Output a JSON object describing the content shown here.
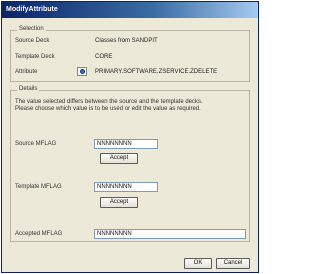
{
  "window": {
    "title": "ModifyAttribute"
  },
  "selection": {
    "group_title": "Selection",
    "source_deck_label": "Source Deck",
    "source_deck_value": "Classes from SANDPIT",
    "template_deck_label": "Template Deck",
    "template_deck_value": "CORE",
    "attribute_label": "Attribute",
    "attribute_value": "PRIMARY.SOFTWARE.ZSERVICE.ZDELETE"
  },
  "details": {
    "group_title": "Details",
    "description_line1": "The value selected differs between the source and the template decks.",
    "description_line2": "Please choose which value is to be used or edit the value as required.",
    "source_label": "Source MFLAG",
    "source_value": "NNNNNNNN",
    "source_accept": "Accept",
    "template_label": "Template MFLAG",
    "template_value": "NNNNNNNN",
    "template_accept": "Accept",
    "accepted_label": "Accepted MFLAG",
    "accepted_value": "NNNNNNNN"
  },
  "footer": {
    "ok_label": "OK",
    "cancel_label": "Cancel"
  },
  "icons": {
    "attribute_browse": "browse-icon"
  }
}
